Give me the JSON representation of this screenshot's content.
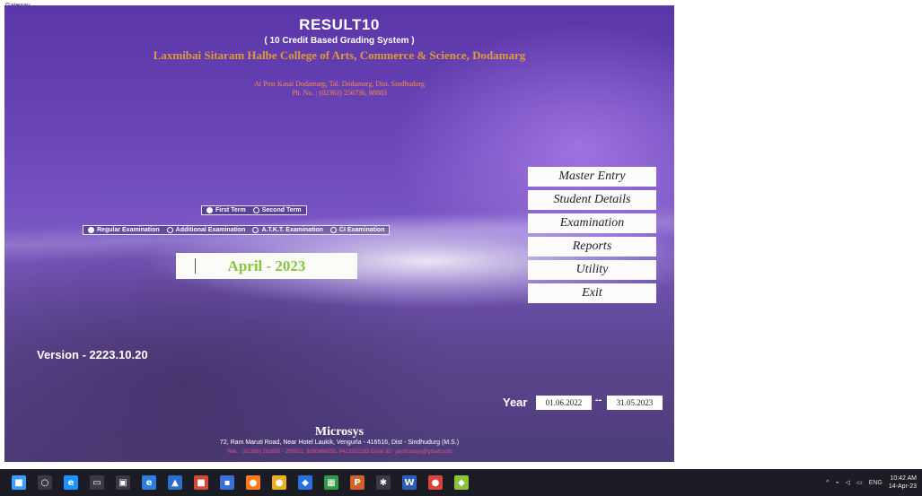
{
  "window": {
    "caption": "Gateway"
  },
  "app": {
    "title": "RESULT10",
    "subtitle": "( 10 Credit Based Grading System )",
    "college_name": "Laxmibai Sitaram Halbe College of Arts, Commerce & Science, Dodamarg",
    "college_address": "At Post Kasai Dodamarg, Tal. Dodamarg, Dist. Sindhudurg",
    "college_phone": "Ph. No. : (02363) 256736, 88883"
  },
  "term_options": [
    {
      "label": "First Term",
      "selected": true
    },
    {
      "label": "Second Term",
      "selected": false
    }
  ],
  "exam_options": [
    {
      "label": "Regular Examination",
      "selected": true
    },
    {
      "label": "Additional Examination",
      "selected": false
    },
    {
      "label": "A.T.K.T. Examination",
      "selected": false
    },
    {
      "label": "CI Examination",
      "selected": false
    }
  ],
  "session": "April - 2023",
  "menu": [
    "Master Entry",
    "Student Details",
    "Examination",
    "Reports",
    "Utility",
    "Exit"
  ],
  "version": "Version - 2223.10.20",
  "year": {
    "label": "Year",
    "from": "01.06.2022",
    "separator": "--",
    "to": "31.05.2023"
  },
  "footer": {
    "company": "Microsys",
    "address": "72, Ram Maruti Road, Near Hotel Laukik, Vengurla - 416516, Dist - Sindhudurg (M.S.)",
    "contact": "Tele. : (02366) 262695 - 299931, 9890668050, 9423302183 Email ID : jaimicrosys@gmail.com"
  },
  "taskbar": {
    "icons": [
      {
        "name": "windows-start-icon",
        "glyph": "■",
        "color": "#3aa0ff"
      },
      {
        "name": "search-icon",
        "glyph": "○",
        "color": "#3a3a44"
      },
      {
        "name": "edge-legacy-icon",
        "glyph": "e",
        "color": "#1e90ff"
      },
      {
        "name": "task-view-icon",
        "glyph": "▭",
        "color": "#3a3a44"
      },
      {
        "name": "store-icon",
        "glyph": "▣",
        "color": "#3a3a44"
      },
      {
        "name": "edge-icon",
        "glyph": "e",
        "color": "#2a7de1"
      },
      {
        "name": "photos-icon",
        "glyph": "▲",
        "color": "#2a6fd0"
      },
      {
        "name": "media-icon",
        "glyph": "■",
        "color": "#d04a3a"
      },
      {
        "name": "app-icon",
        "glyph": "▪",
        "color": "#3a6fd8"
      },
      {
        "name": "firefox-icon",
        "glyph": "●",
        "color": "#ff7a1a"
      },
      {
        "name": "chrome-icon",
        "glyph": "●",
        "color": "#e8b323"
      },
      {
        "name": "teamviewer-icon",
        "glyph": "◆",
        "color": "#2a6fe0"
      },
      {
        "name": "sheets-icon",
        "glyph": "▦",
        "color": "#2f9a4a"
      },
      {
        "name": "powerpoint-icon",
        "glyph": "P",
        "color": "#d4612a"
      },
      {
        "name": "settings-icon",
        "glyph": "✱",
        "color": "#3a3a44"
      },
      {
        "name": "word-icon",
        "glyph": "W",
        "color": "#2b5fb9"
      },
      {
        "name": "chrome-alt-icon",
        "glyph": "●",
        "color": "#db4437"
      },
      {
        "name": "green-app-icon",
        "glyph": "◆",
        "color": "#8ac43a"
      }
    ],
    "tray_lang": "ENG",
    "time": "10:42 AM",
    "date": "14-Apr-23"
  }
}
